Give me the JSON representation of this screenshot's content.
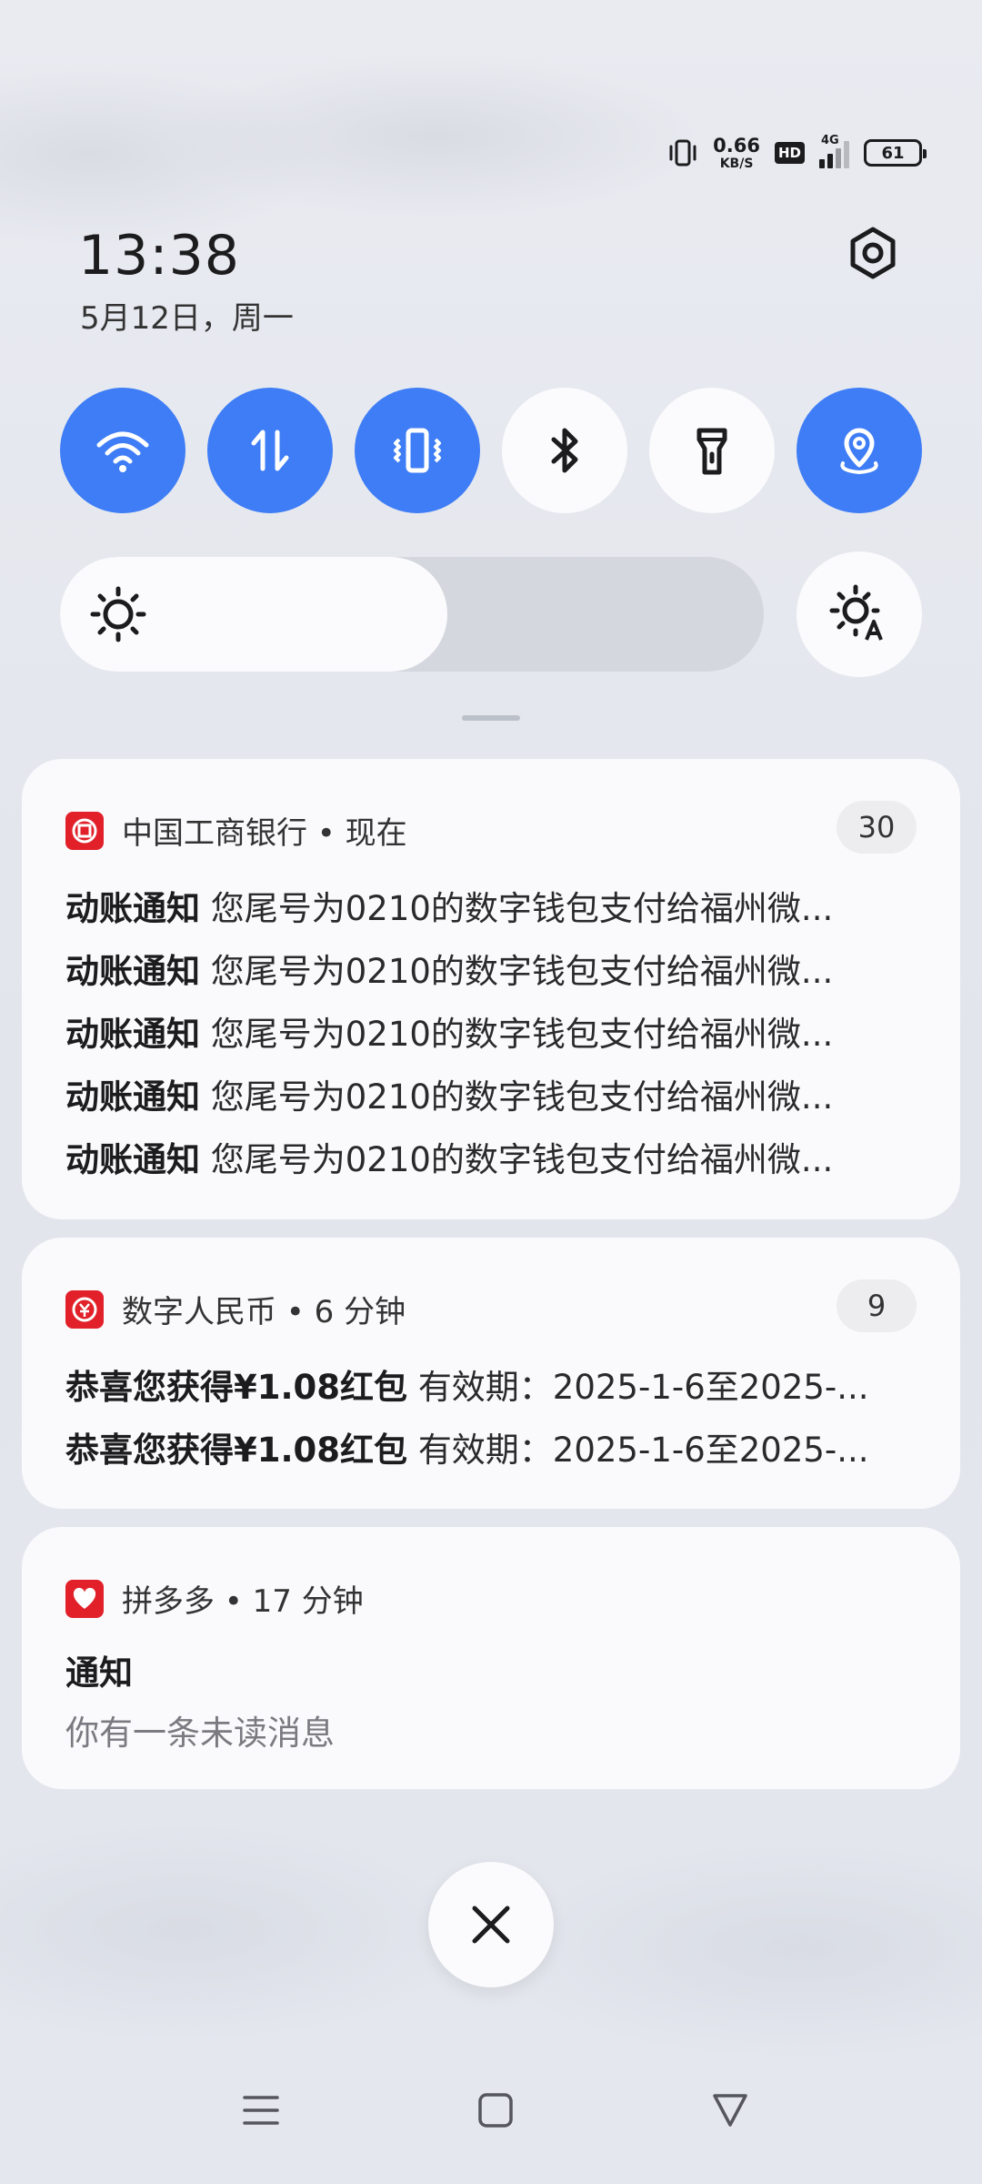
{
  "status_bar": {
    "net_speed_value": "0.66",
    "net_speed_unit": "KB/S",
    "hd_label": "HD",
    "network_type": "4G",
    "battery_level": "61"
  },
  "header": {
    "time": "13:38",
    "date": "5月12日，周一"
  },
  "quick_tiles": [
    {
      "name": "wifi",
      "icon": "wifi-icon",
      "on": true
    },
    {
      "name": "mobile-data",
      "icon": "data-transfer-icon",
      "on": true
    },
    {
      "name": "vibrate",
      "icon": "vibrate-icon",
      "on": true
    },
    {
      "name": "bluetooth",
      "icon": "bluetooth-icon",
      "on": false
    },
    {
      "name": "flashlight",
      "icon": "flashlight-icon",
      "on": false
    },
    {
      "name": "location",
      "icon": "location-icon",
      "on": true
    }
  ],
  "brightness": {
    "level": 0.55
  },
  "notifications": [
    {
      "app": "中国工商银行",
      "time": "现在",
      "header": "中国工商银行 • 现在",
      "count": "30",
      "lines": [
        {
          "title": "动账通知",
          "text": "您尾号为0210的数字钱包支付给福州微..."
        },
        {
          "title": "动账通知",
          "text": "您尾号为0210的数字钱包支付给福州微..."
        },
        {
          "title": "动账通知",
          "text": "您尾号为0210的数字钱包支付给福州微..."
        },
        {
          "title": "动账通知",
          "text": "您尾号为0210的数字钱包支付给福州微..."
        },
        {
          "title": "动账通知",
          "text": "您尾号为0210的数字钱包支付给福州微..."
        }
      ]
    },
    {
      "app": "数字人民币",
      "time": "6 分钟",
      "header": "数字人民币 • 6 分钟",
      "count": "9",
      "lines": [
        {
          "title": "恭喜您获得¥1.08红包",
          "text": "有效期：2025-1-6至2025-..."
        },
        {
          "title": "恭喜您获得¥1.08红包",
          "text": "有效期：2025-1-6至2025-..."
        }
      ]
    },
    {
      "app": "拼多多",
      "time": "17 分钟",
      "header": "拼多多 • 17 分钟",
      "title": "通知",
      "body": "你有一条未读消息"
    }
  ],
  "colors": {
    "accent": "#3e7df6",
    "tile_off": "#fbfbfd",
    "app_red": "#e1202a"
  }
}
